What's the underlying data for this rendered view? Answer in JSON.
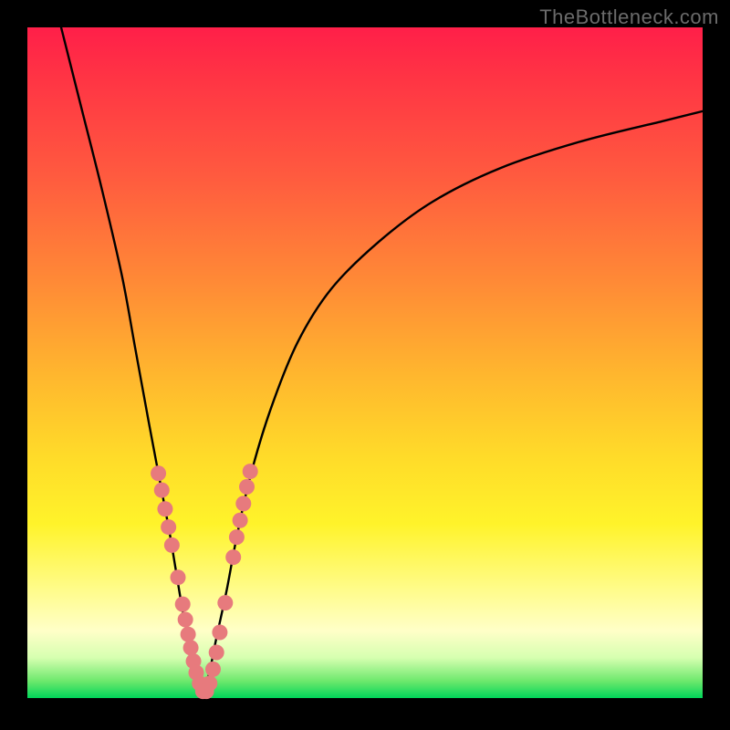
{
  "watermark": "TheBottleneck.com",
  "colors": {
    "curve": "#000000",
    "marker": "#e77a7d",
    "gradient_top": "#ff1f49",
    "gradient_bottom": "#00d65a",
    "frame": "#000000"
  },
  "chart_data": {
    "type": "line",
    "title": "",
    "xlabel": "",
    "ylabel": "",
    "xlim": [
      0,
      100
    ],
    "ylim": [
      0,
      100
    ],
    "series": [
      {
        "name": "curve-left",
        "x": [
          5,
          8,
          11,
          14,
          16,
          18,
          19.5,
          21,
          22,
          23,
          24,
          25,
          26
        ],
        "y": [
          100,
          88,
          76,
          63,
          52,
          41,
          33,
          25,
          19,
          13,
          8,
          4,
          0.5
        ]
      },
      {
        "name": "curve-right",
        "x": [
          26,
          27,
          28,
          29.5,
          31,
          33,
          36,
          40,
          45,
          52,
          60,
          70,
          82,
          94,
          100
        ],
        "y": [
          0.5,
          4,
          9,
          16,
          24,
          33,
          43,
          53,
          61,
          68,
          74,
          79,
          83,
          86,
          87.5
        ]
      }
    ],
    "markers": {
      "name": "highlight-dots",
      "color": "#e77a7d",
      "points": [
        [
          19.4,
          33.5
        ],
        [
          19.9,
          31.0
        ],
        [
          20.4,
          28.2
        ],
        [
          20.9,
          25.5
        ],
        [
          21.4,
          22.8
        ],
        [
          22.3,
          18.0
        ],
        [
          23.0,
          14.0
        ],
        [
          23.4,
          11.7
        ],
        [
          23.8,
          9.5
        ],
        [
          24.2,
          7.5
        ],
        [
          24.6,
          5.5
        ],
        [
          25.0,
          3.8
        ],
        [
          25.5,
          2.2
        ],
        [
          26.0,
          1.0
        ],
        [
          26.5,
          1.0
        ],
        [
          27.0,
          2.2
        ],
        [
          27.5,
          4.3
        ],
        [
          28.0,
          6.8
        ],
        [
          28.5,
          9.8
        ],
        [
          29.3,
          14.2
        ],
        [
          30.5,
          21.0
        ],
        [
          31.0,
          24.0
        ],
        [
          31.5,
          26.5
        ],
        [
          32.0,
          29.0
        ],
        [
          32.5,
          31.5
        ],
        [
          33.0,
          33.8
        ]
      ]
    }
  }
}
